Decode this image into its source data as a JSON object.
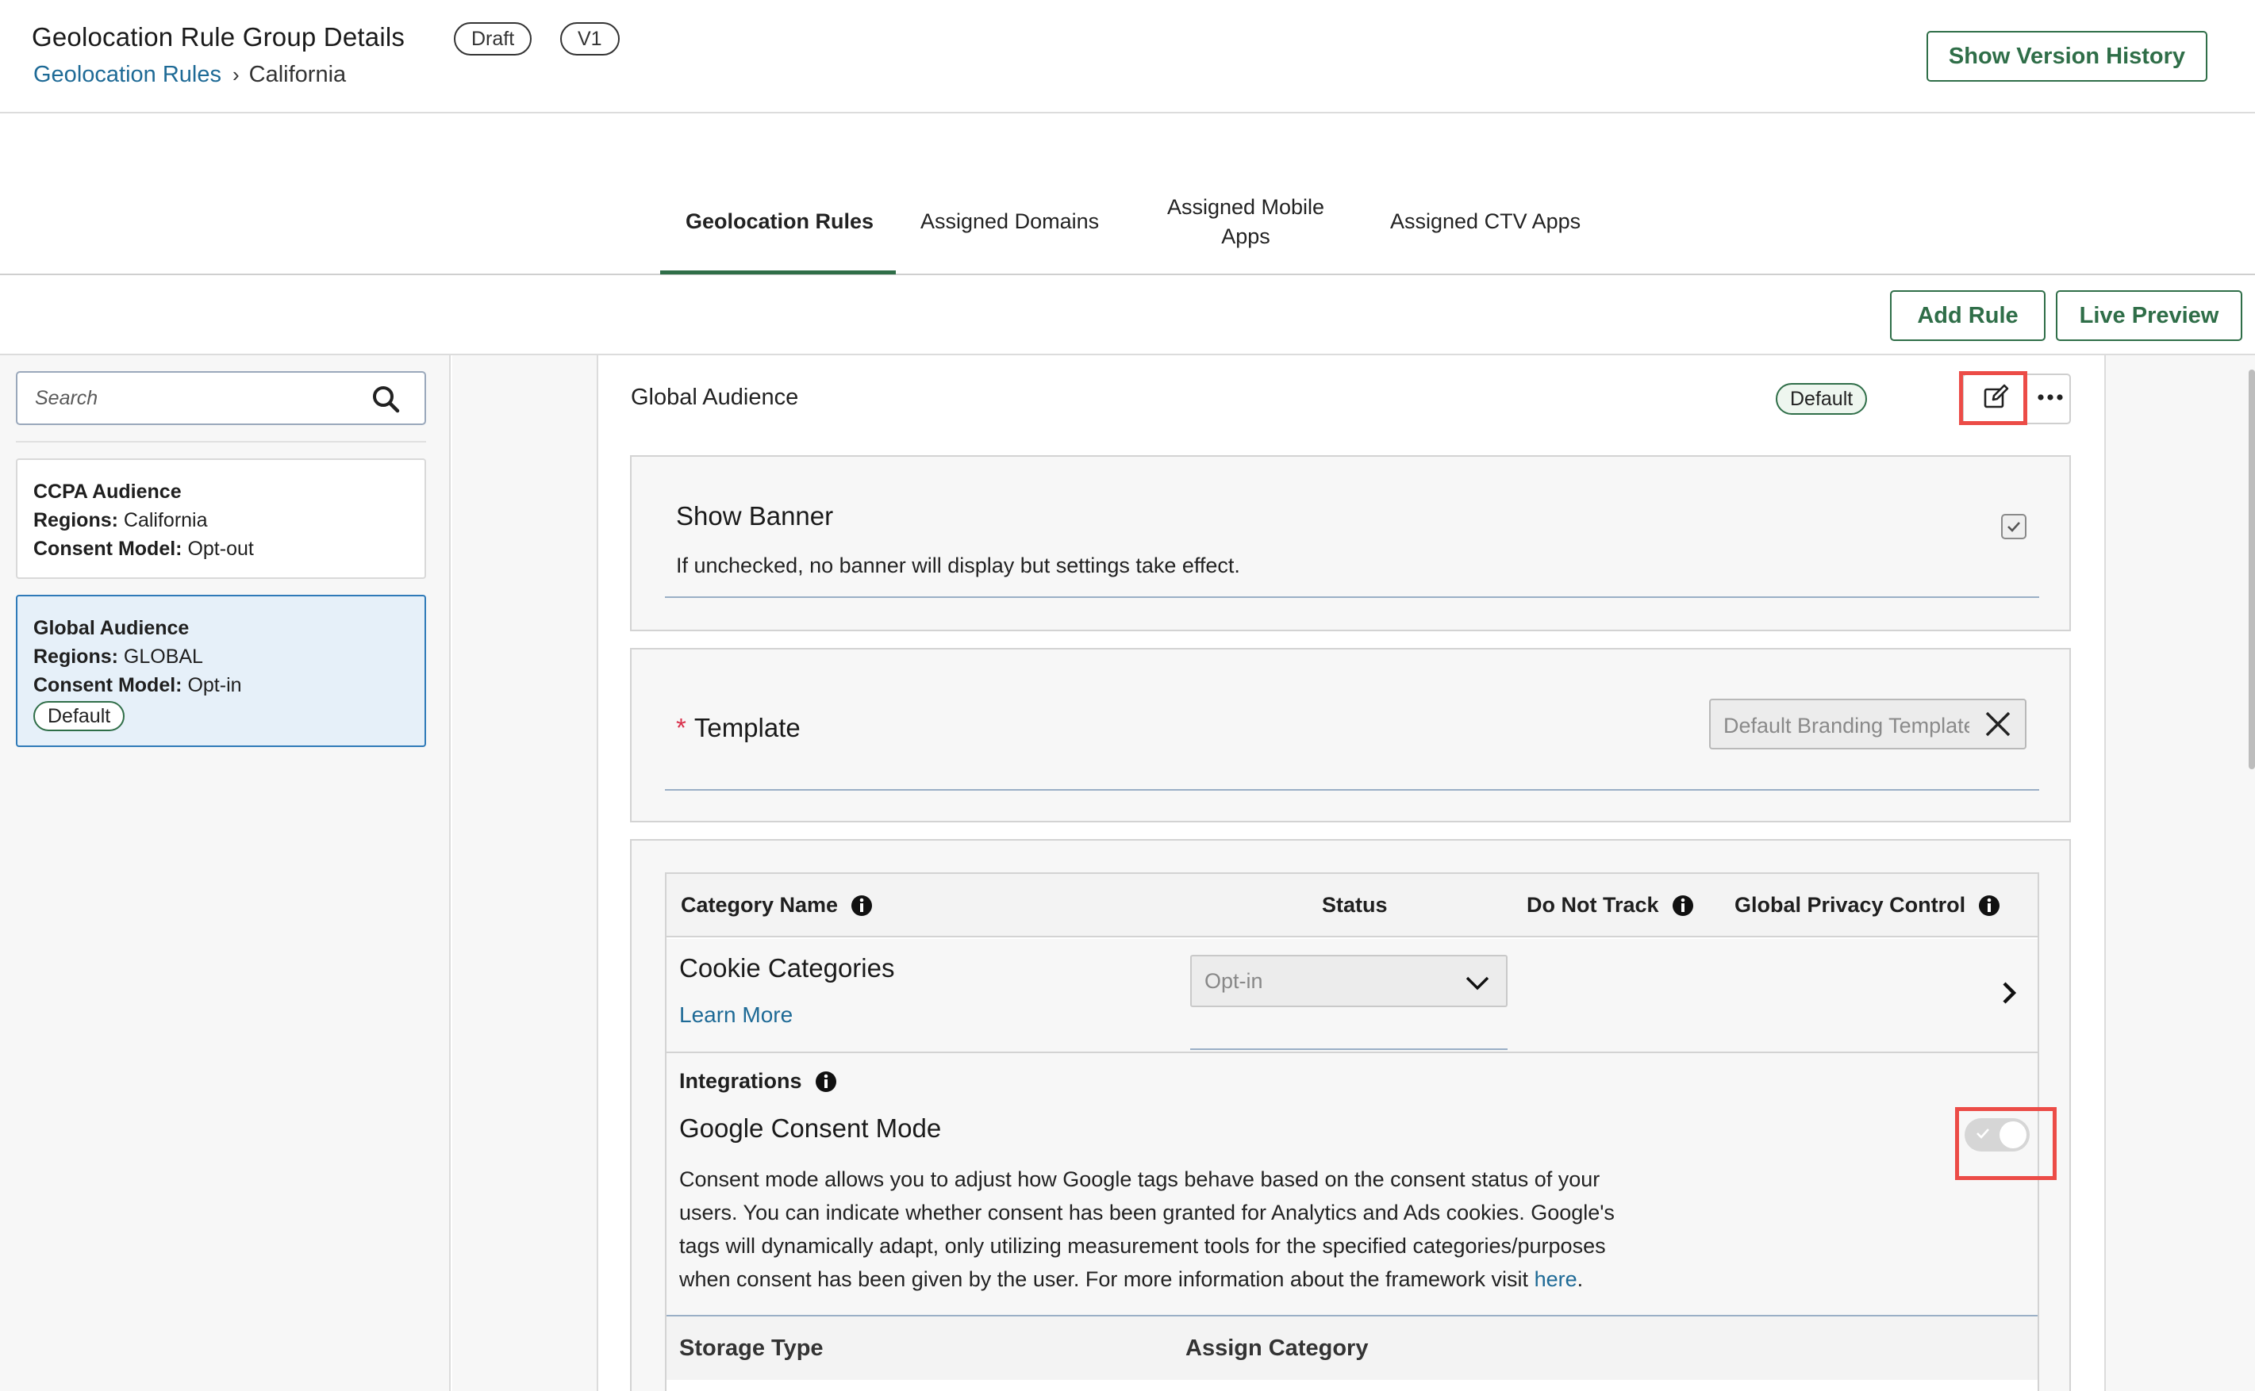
{
  "header": {
    "title": "Geolocation Rule Group Details",
    "status_badge": "Draft",
    "version_badge": "V1",
    "breadcrumb": {
      "parent": "Geolocation Rules",
      "separator": "›",
      "current": "California"
    },
    "show_version_history_label": "Show Version History"
  },
  "tabs": [
    {
      "label": "Geolocation Rules",
      "active": true
    },
    {
      "label": "Assigned Domains",
      "active": false
    },
    {
      "label": "Assigned Mobile Apps",
      "active": false
    },
    {
      "label": "Assigned CTV Apps",
      "active": false
    }
  ],
  "actions": {
    "add_rule_label": "Add Rule",
    "live_preview_label": "Live Preview"
  },
  "sidebar": {
    "search": {
      "placeholder": "Search",
      "value": ""
    },
    "rules": [
      {
        "name": "CCPA Audience",
        "regions_label": "Regions:",
        "regions": "California",
        "consent_label": "Consent Model:",
        "consent": "Opt-out",
        "badge": "",
        "selected": false
      },
      {
        "name": "Global Audience",
        "regions_label": "Regions:",
        "regions": "GLOBAL",
        "consent_label": "Consent Model:",
        "consent": "Opt-in",
        "badge": "Default",
        "selected": true
      }
    ]
  },
  "rule_detail": {
    "title": "Global Audience",
    "badge": "Default",
    "icons": {
      "edit": "edit-icon",
      "more": "more-horizontal-icon"
    },
    "show_banner": {
      "title": "Show Banner",
      "description": "If unchecked, no banner will display but settings take effect.",
      "checked": true
    },
    "template": {
      "required_marker": "*",
      "label": "Template",
      "value": "Default Branding Template",
      "clear_icon": "close-icon"
    },
    "categories_table": {
      "headers": {
        "category_name": "Category Name",
        "status": "Status",
        "do_not_track": "Do Not Track",
        "global_privacy_control": "Global Privacy Control"
      },
      "row": {
        "name": "Cookie Categories",
        "link": "Learn More",
        "status": "Opt-in"
      }
    },
    "integrations": {
      "title": "Integrations",
      "gcm_title": "Google Consent Mode",
      "gcm_description": "Consent mode allows you to adjust how Google tags behave based on the consent status of your users. You can indicate whether consent has been granted for Analytics and Ads cookies. Google's tags will dynamically adapt, only utilizing measurement tools for the specified categories/purposes when consent has been given by the user. For more information about the framework visit",
      "gcm_link": "here",
      "gcm_period": ".",
      "toggle_on": false
    },
    "storage_table": {
      "storage_type": "Storage Type",
      "assign_category": "Assign Category"
    }
  },
  "colors": {
    "brand_green": "#2f6e48",
    "link_blue": "#1e6a96",
    "selected_bg": "#e6f0f9",
    "selected_border": "#2f7ab8",
    "highlight_red": "#ec4c47",
    "required_red": "#d9304b"
  }
}
